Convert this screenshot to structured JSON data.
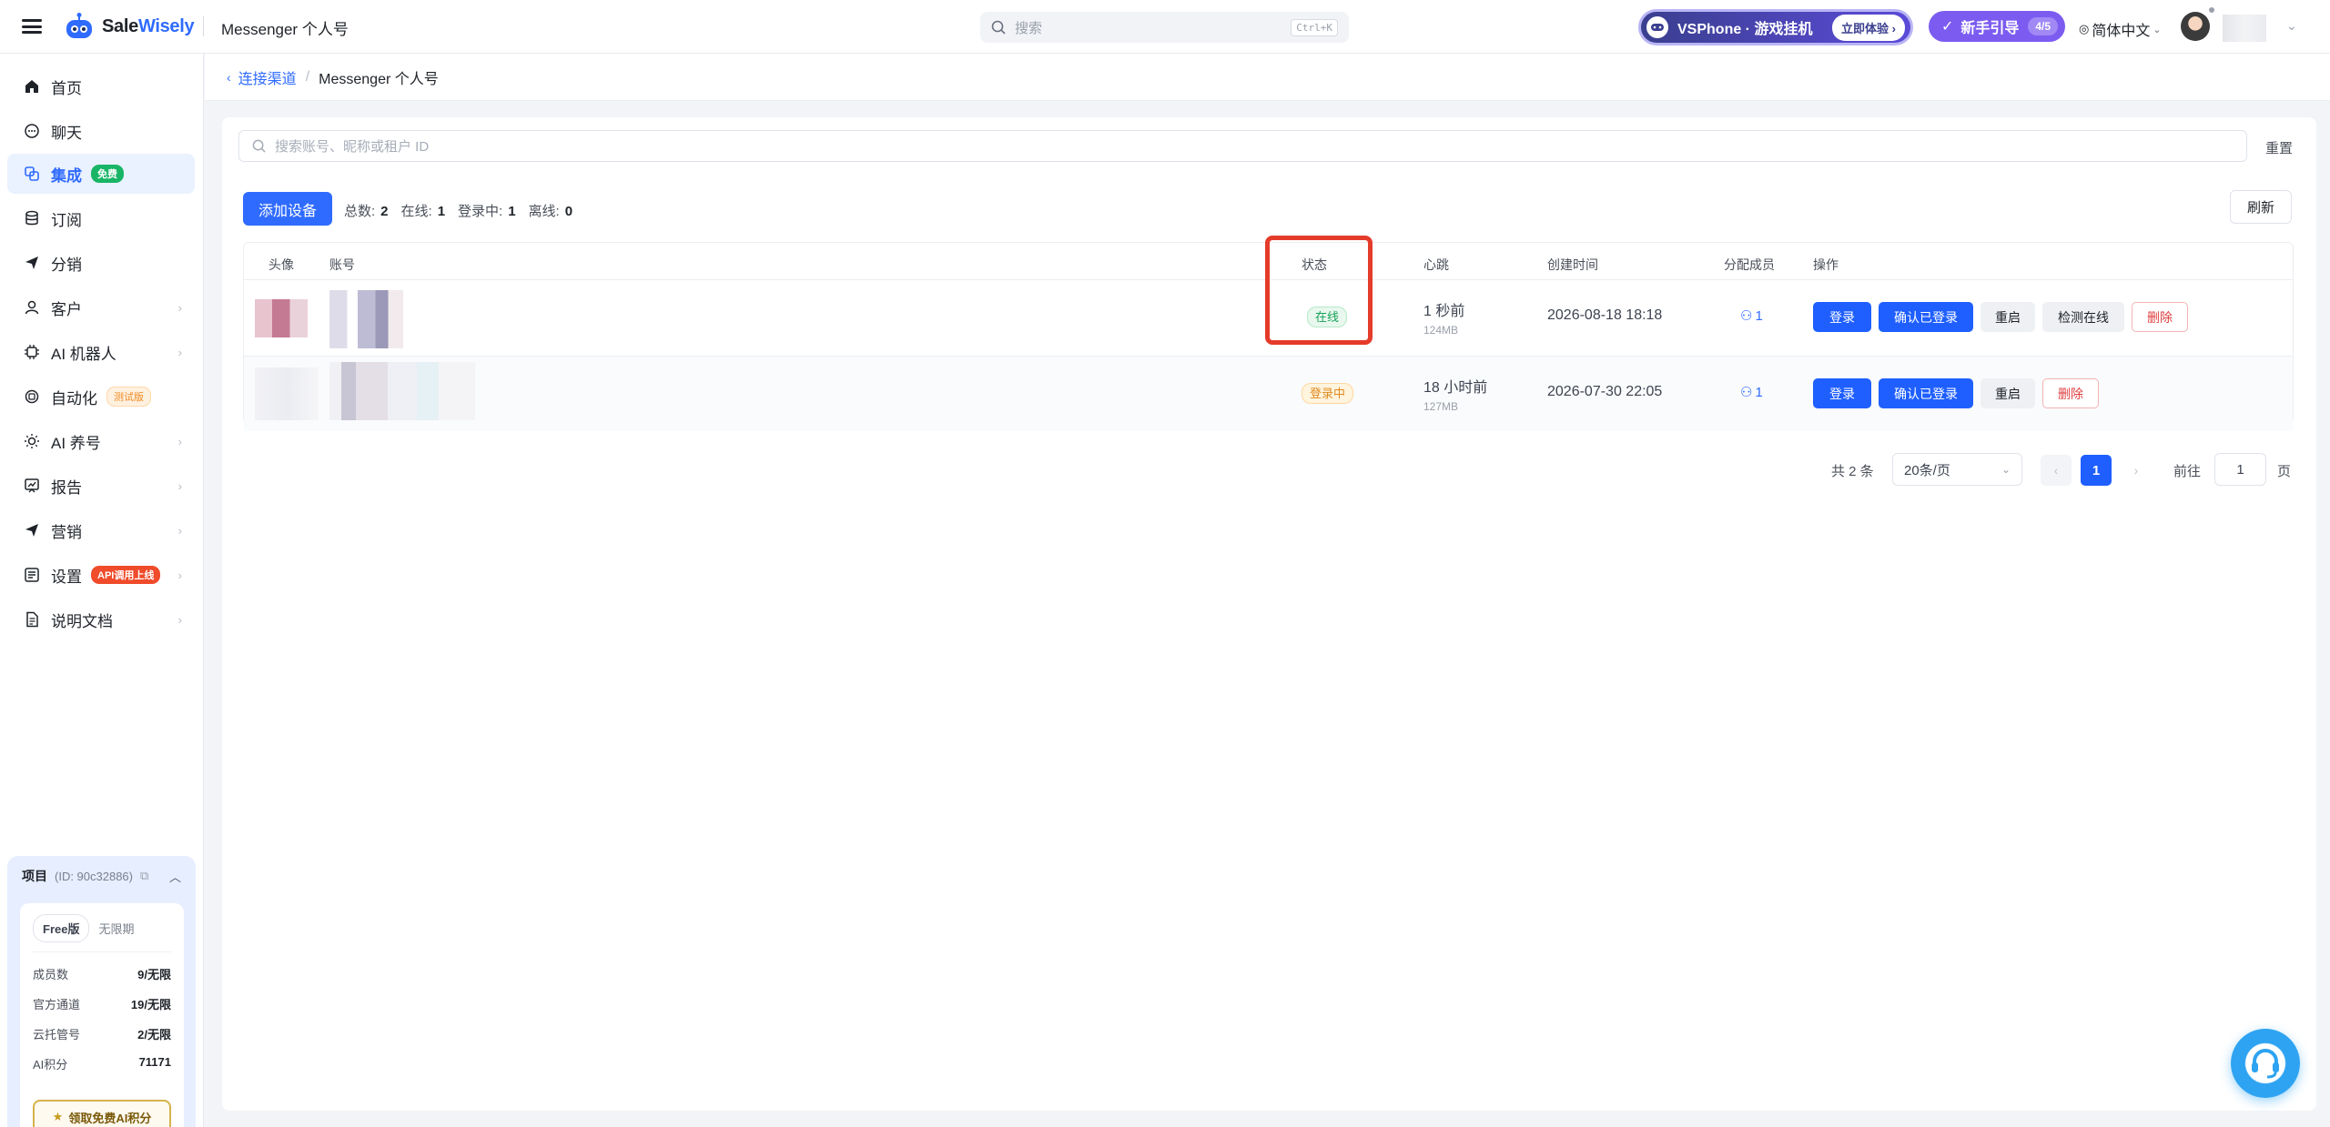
{
  "app": {
    "logo_sale": "Sale",
    "logo_wisely": "Wisely",
    "page_title": "Messenger 个人号"
  },
  "top": {
    "search_placeholder": "搜索",
    "search_shortcut": "Ctrl+K",
    "vsphone_text": "VSPhone · 游戏挂机",
    "vsphone_cta": "立即体验",
    "guide_label": "新手引导",
    "guide_progress": "4/5",
    "language": "简体中文"
  },
  "sidebar": {
    "items": [
      {
        "label": "首页",
        "icon": "home-icon"
      },
      {
        "label": "聊天",
        "icon": "chat-icon"
      },
      {
        "label": "集成",
        "icon": "integration-icon",
        "tag": "免费"
      },
      {
        "label": "订阅",
        "icon": "database-icon"
      },
      {
        "label": "分销",
        "icon": "send-icon"
      },
      {
        "label": "客户",
        "icon": "user-icon"
      },
      {
        "label": "AI 机器人",
        "icon": "chip-icon"
      },
      {
        "label": "自动化",
        "icon": "automation-icon",
        "tag": "测试版"
      },
      {
        "label": "AI 养号",
        "icon": "sun-icon"
      },
      {
        "label": "报告",
        "icon": "report-icon"
      },
      {
        "label": "营销",
        "icon": "megaphone-icon"
      },
      {
        "label": "设置",
        "icon": "settings-icon",
        "tag": "API调用上线"
      },
      {
        "label": "说明文档",
        "icon": "doc-icon"
      }
    ]
  },
  "project": {
    "title": "项目",
    "id_text": "(ID: 90c32886)",
    "plan": "Free版",
    "period": "无限期",
    "stats": [
      {
        "label": "成员数",
        "value": "9/无限"
      },
      {
        "label": "官方通道",
        "value": "19/无限"
      },
      {
        "label": "云托管号",
        "value": "2/无限"
      },
      {
        "label": "AI积分",
        "value": "71171"
      }
    ],
    "claim_label": "领取免费AI积分"
  },
  "breadcrumb": {
    "parent": "连接渠道",
    "current": "Messenger 个人号"
  },
  "filter": {
    "search_placeholder": "搜索账号、昵称或租户 ID",
    "reset_label": "重置"
  },
  "toolbar": {
    "add_label": "添加设备",
    "total_label": "总数:",
    "total_value": "2",
    "online_label": "在线:",
    "online_value": "1",
    "logging_label": "登录中:",
    "logging_value": "1",
    "offline_label": "离线:",
    "offline_value": "0",
    "refresh_label": "刷新"
  },
  "table": {
    "headers": [
      "头像",
      "账号",
      "状态",
      "心跳",
      "创建时间",
      "分配成员",
      "操作"
    ],
    "rows": [
      {
        "status": "在线",
        "heartbeat": "1 秒前",
        "memory": "124MB",
        "created": "2026-08-18 18:18",
        "members": "1",
        "actions": [
          "登录",
          "确认已登录",
          "重启",
          "检测在线",
          "删除"
        ]
      },
      {
        "status": "登录中",
        "heartbeat": "18 小时前",
        "memory": "127MB",
        "created": "2026-07-30 22:05",
        "members": "1",
        "actions": [
          "登录",
          "确认已登录",
          "重启",
          "删除"
        ]
      }
    ]
  },
  "pagination": {
    "total_text": "共 2 条",
    "page_size": "20条/页",
    "current_page": "1",
    "goto_label": "前往",
    "goto_value": "1",
    "goto_unit": "页"
  },
  "colors": {
    "accent": "#2f6bff",
    "highlight": "#e53b2a",
    "online": "#18a058",
    "logging": "#e08a1e",
    "danger": "#e04040"
  }
}
